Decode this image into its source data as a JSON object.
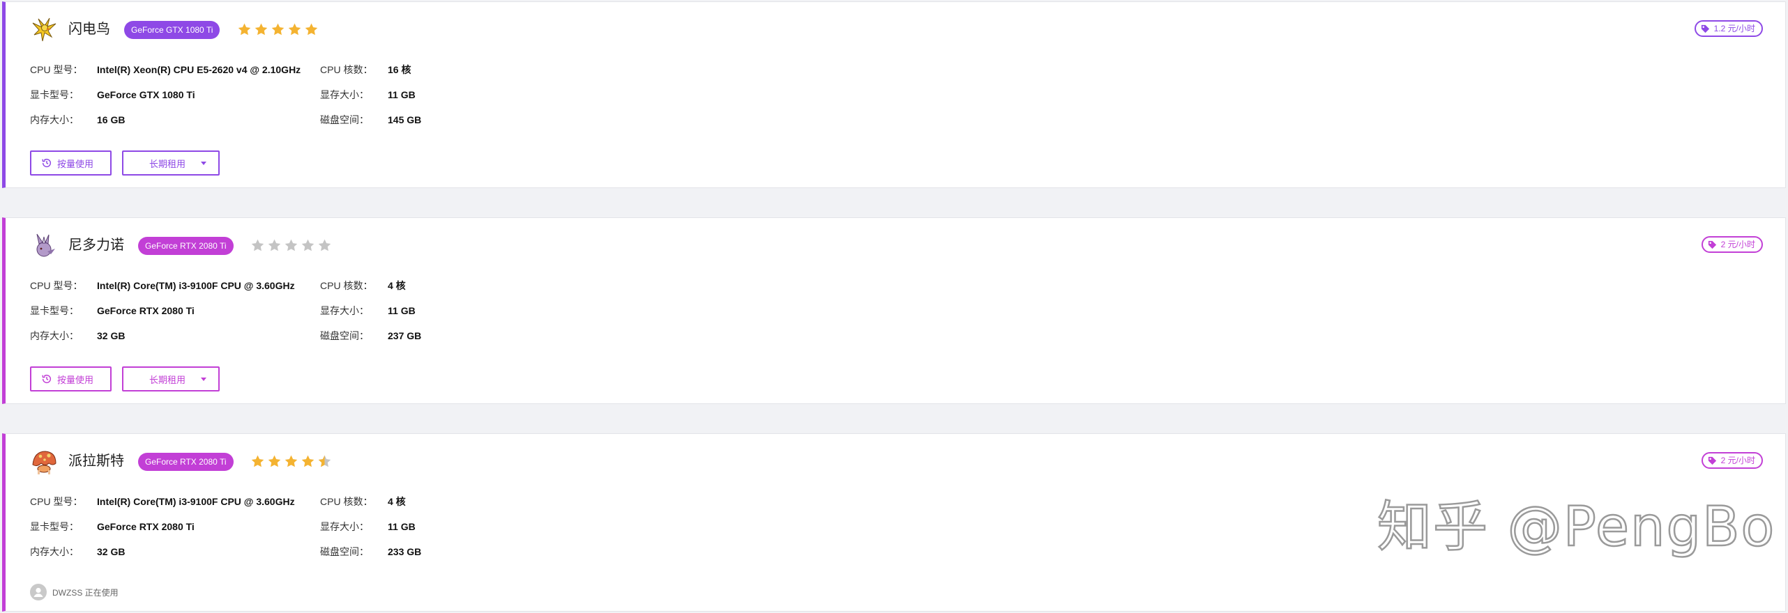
{
  "theme": {
    "purple": "#8e49e6",
    "magenta": "#c23fd6",
    "star_active": "#f4b331",
    "star_inactive": "#c4c4c4"
  },
  "spec_labels": {
    "cpu_model": "CPU 型号：",
    "cpu_cores": "CPU 核数：",
    "gpu_model": "显卡型号：",
    "gpu_memory": "显存大小：",
    "ram": "内存大小：",
    "disk": "磁盘空间："
  },
  "actions": {
    "on_demand": "按量使用",
    "long_term": "长期租用"
  },
  "machines": [
    {
      "name": "闪电鸟",
      "gpu_badge": "GeForce GTX 1080 Ti",
      "rating": 5,
      "price": "1.2 元/小时",
      "cpu_model": "Intel(R) Xeon(R) CPU E5-2620 v4 @ 2.10GHz",
      "cpu_cores": "16 核",
      "gpu_model": "GeForce GTX 1080 Ti",
      "gpu_memory": "11 GB",
      "ram": "16 GB",
      "disk": "145 GB",
      "accent": "purple",
      "icon": "zapdos-avatar-icon"
    },
    {
      "name": "尼多力诺",
      "gpu_badge": "GeForce RTX 2080 Ti",
      "rating": 0,
      "price": "2 元/小时",
      "cpu_model": "Intel(R) Core(TM) i3-9100F CPU @ 3.60GHz",
      "cpu_cores": "4 核",
      "gpu_model": "GeForce RTX 2080 Ti",
      "gpu_memory": "11 GB",
      "ram": "32 GB",
      "disk": "237 GB",
      "accent": "magenta",
      "icon": "nidorino-avatar-icon"
    },
    {
      "name": "派拉斯特",
      "gpu_badge": "GeForce RTX 2080 Ti",
      "rating": 4.5,
      "price": "2 元/小时",
      "cpu_model": "Intel(R) Core(TM) i3-9100F CPU @ 3.60GHz",
      "cpu_cores": "4 核",
      "gpu_model": "GeForce RTX 2080 Ti",
      "gpu_memory": "11 GB",
      "ram": "32 GB",
      "disk": "233 GB",
      "accent": "magenta",
      "icon": "parasect-avatar-icon",
      "in_use": "DWZSS 正在使用"
    }
  ],
  "watermark": "知乎 @PengBo"
}
